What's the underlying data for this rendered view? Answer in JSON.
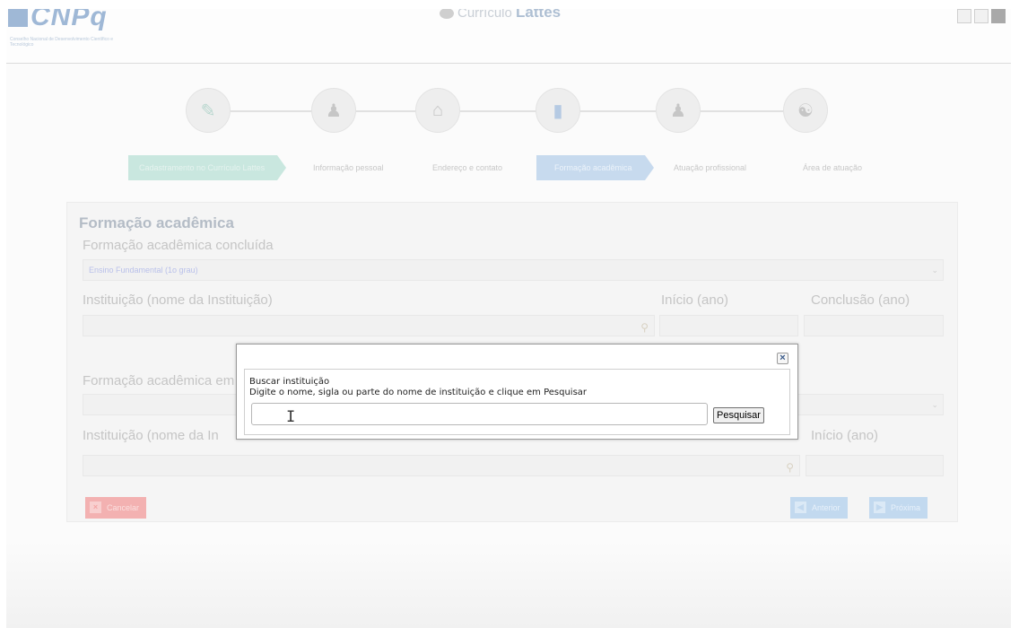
{
  "header": {
    "logo_text": "CNPq",
    "logo_subtitle": "Conselho Nacional de Desenvolvimento Científico e Tecnológico",
    "system_label": "Currículo",
    "system_name": "Lattes"
  },
  "steps": {
    "icons": [
      "document-check-icon",
      "person-icon",
      "house-icon",
      "book-icon",
      "professional-icon",
      "person-area-icon"
    ],
    "labels": [
      "Cadastramento no Currículo Lattes",
      "Informação pessoal",
      "Endereço e contato",
      "Formação acadêmica",
      "Atuação profissional",
      "Área de atuação"
    ],
    "current_index": 3
  },
  "form": {
    "section_title": "Formação acadêmica",
    "concluded_label": "Formação acadêmica concluída",
    "concluded_value": "Ensino Fundamental (1o grau)",
    "institution_label": "Instituição (nome da Instituição)",
    "start_label": "Início (ano)",
    "end_label": "Conclusão (ano)",
    "ongoing_label_partial": "Formação acadêmica em",
    "institution2_label_partial": "Instituição (nome da In",
    "start2_label": "Início (ano)",
    "cancel_label": "Cancelar",
    "previous_label": "Anterior",
    "next_label": "Próxima"
  },
  "modal": {
    "close_glyph": "×",
    "title": "Buscar instituição",
    "hint": "Digite o nome, sigla ou parte do nome de instituição e clique em Pesquisar",
    "input_value": "",
    "search_button": "Pesquisar"
  }
}
